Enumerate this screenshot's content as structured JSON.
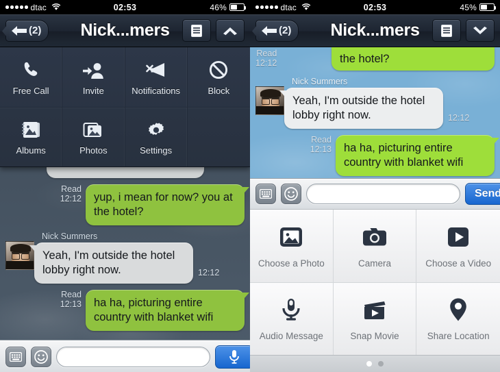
{
  "left": {
    "status": {
      "carrier": "dtac",
      "signal_dots": 5,
      "time": "02:53",
      "battery_pct": "46%",
      "battery_level": 46
    },
    "nav": {
      "back_count": "(2)",
      "title": "Nick...mers",
      "menu_icon": "list-icon",
      "chevron_icon": "chevron-up-icon"
    },
    "menu": {
      "items": [
        {
          "label": "Free Call",
          "icon": "phone-icon"
        },
        {
          "label": "Invite",
          "icon": "add-person-icon"
        },
        {
          "label": "Notifications",
          "icon": "megaphone-mute-icon"
        },
        {
          "label": "Block",
          "icon": "block-icon"
        },
        {
          "label": "Albums",
          "icon": "albums-icon"
        },
        {
          "label": "Photos",
          "icon": "photos-icon"
        },
        {
          "label": "Settings",
          "icon": "gear-icon"
        }
      ]
    },
    "messages": [
      {
        "dir": "out",
        "text": "yup, i mean for now? you at the hotel?",
        "status": "Read",
        "time": "12:12"
      },
      {
        "dir": "in",
        "sender": "Nick Summers",
        "text": "Yeah, I'm outside the hotel lobby right now.",
        "time": "12:12"
      },
      {
        "dir": "out",
        "text": "ha ha, picturing entire country with blanket wifi",
        "status": "Read",
        "time": "12:13"
      }
    ],
    "input": {
      "keyboard_icon": "keyboard-icon",
      "sticker_icon": "smiley-icon",
      "placeholder": "",
      "value": "",
      "mic_icon": "microphone-icon"
    }
  },
  "right": {
    "status": {
      "carrier": "dtac",
      "signal_dots": 5,
      "time": "02:53",
      "battery_pct": "45%",
      "battery_level": 45
    },
    "nav": {
      "back_count": "(2)",
      "title": "Nick...mers",
      "menu_icon": "list-icon",
      "chevron_icon": "chevron-down-icon"
    },
    "messages": [
      {
        "dir": "out",
        "text": "the hotel?",
        "status": "Read",
        "time": "12:12",
        "clipped": true
      },
      {
        "dir": "in",
        "sender": "Nick Summers",
        "text": "Yeah, I'm outside the hotel lobby right now.",
        "time": "12:12"
      },
      {
        "dir": "out",
        "text": "ha ha, picturing entire country with blanket wifi",
        "status": "Read",
        "time": "12:13"
      }
    ],
    "input": {
      "keyboard_icon": "keyboard-icon",
      "sticker_icon": "smiley-icon",
      "placeholder": "",
      "value": "",
      "send_label": "Send"
    },
    "attachments": {
      "items": [
        {
          "label": "Choose a Photo",
          "icon": "photo-icon"
        },
        {
          "label": "Camera",
          "icon": "camera-icon"
        },
        {
          "label": "Choose a Video",
          "icon": "video-play-icon"
        },
        {
          "label": "Audio Message",
          "icon": "microphone-icon"
        },
        {
          "label": "Snap Movie",
          "icon": "clapperboard-icon"
        },
        {
          "label": "Share Location",
          "icon": "map-pin-icon"
        }
      ],
      "pages": 2,
      "active_page": 1
    }
  },
  "colors": {
    "accent_blue": "#1766cf",
    "bubble_green": "#9ede3a",
    "bubble_gray": "#eceeef",
    "navbar_dark": "#232c39",
    "sky_blue": "#79b0d6"
  }
}
